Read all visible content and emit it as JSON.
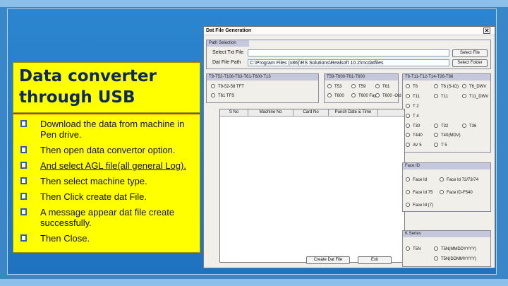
{
  "slide": {
    "title": "Data converter through USB",
    "bullets": [
      {
        "text": "Download the data from machine in Pen drive."
      },
      {
        "text": "Then open data convertor option."
      },
      {
        "text": "And select AGL file(all general Log).",
        "underline": true
      },
      {
        "text": "Then select machine type."
      },
      {
        "text": "Then Click create dat File."
      },
      {
        "text": "A message appear dat file create successfully."
      },
      {
        "text": "Then Close."
      }
    ]
  },
  "window": {
    "title": "Dat File Generation",
    "path_group": {
      "header": "Path Selection",
      "select_txt_label": "Select Txt File",
      "dat_file_path_label": "Dat File Path",
      "txt_file_value": "",
      "dat_path_value": "C:\\Program Files (x86)\\RS Solutions\\Realsoft 10.2\\mcdatfiles",
      "select_file_btn": "Select File",
      "select_folder_btn": "Select Folder"
    },
    "group1": {
      "header": "T9-T52-T108-T63-T61-T600-T13",
      "options": [
        "T9-52-58 TFT",
        "T61 TFS"
      ]
    },
    "group2": {
      "header": "T59-T600-T61-T600",
      "options": [
        "T53",
        "T59",
        "T61",
        "T600",
        "T600 Fay",
        "T600 -Old"
      ]
    },
    "group3": {
      "header": "T6-T11-T12-T14-T26-T66",
      "options": [
        "T6",
        "T6 (S-IO)",
        "T6_DWV",
        "T11",
        "T11",
        "T11_DWV",
        "T 2",
        "T 4",
        "T30",
        "T32",
        "T36",
        "T440",
        "T40(MDV)",
        "AV 5",
        "T 5"
      ]
    },
    "grid": {
      "columns": [
        "S No",
        "Machine No",
        "Card No",
        "Punch Date & Time"
      ]
    },
    "group4": {
      "header": "Face ID",
      "options": [
        "Face Id",
        "Face Id 72/73/74",
        "Face Id 75",
        "Face ID-F540",
        "Face Id (7)"
      ]
    },
    "group5": {
      "header": "K Series",
      "options": [
        "T5N",
        "T5N(MMDDYYYY)",
        "T5N(DDMMYYYY)"
      ]
    },
    "buttons": {
      "create": "Create Dat File",
      "exit": "Exit"
    }
  }
}
